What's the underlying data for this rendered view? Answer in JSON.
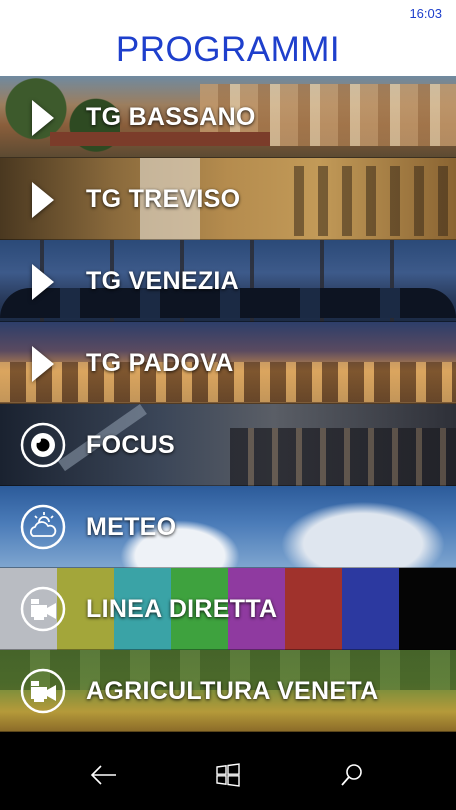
{
  "status": {
    "time": "16:03"
  },
  "header": {
    "title": "PROGRAMMI"
  },
  "colors": {
    "accent": "#1e3fcc"
  },
  "programs": [
    {
      "label": "TG BASSANO",
      "icon": "play-arrow-icon"
    },
    {
      "label": "TG TREVISO",
      "icon": "play-arrow-icon"
    },
    {
      "label": "TG VENEZIA",
      "icon": "play-arrow-icon"
    },
    {
      "label": "TG PADOVA",
      "icon": "play-arrow-icon"
    },
    {
      "label": "FOCUS",
      "icon": "focus-icon"
    },
    {
      "label": "METEO",
      "icon": "weather-icon"
    },
    {
      "label": "LINEA DIRETTA",
      "icon": "tv-camera-icon"
    },
    {
      "label": "AGRICULTURA VENETA",
      "icon": "tv-camera-icon"
    }
  ],
  "linea_diretta_bars": [
    "#b9bcc2",
    "#a3a63a",
    "#3aa3a6",
    "#3ea23e",
    "#8f3aa0",
    "#a0322c",
    "#2c39a0",
    "#050505"
  ],
  "navbar": {
    "back": "back-arrow-icon",
    "home": "windows-logo-icon",
    "search": "search-icon"
  }
}
